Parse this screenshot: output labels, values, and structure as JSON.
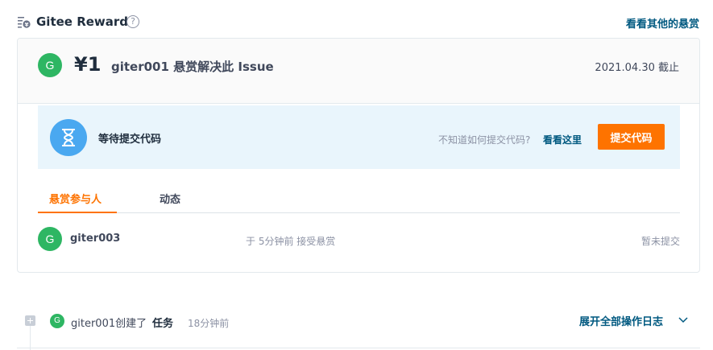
{
  "header": {
    "title": "Gitee Reward",
    "help_icon": "question-circle-icon",
    "help_glyph": "?",
    "other_link": "看看其他的悬赏"
  },
  "reward": {
    "avatar_letter": "G",
    "amount": "¥1",
    "title": "giter001 悬赏解决此 Issue",
    "deadline": "2021.04.30 截止"
  },
  "status": {
    "icon": "hourglass-icon",
    "text": "等待提交代码",
    "hint": "不知道如何提交代码?",
    "hint_link": "看看这里",
    "submit_label": "提交代码"
  },
  "tabs": [
    {
      "label": "悬赏参与人",
      "active": true
    },
    {
      "label": "动态",
      "active": false
    }
  ],
  "participants": [
    {
      "avatar_letter": "G",
      "name": "giter003",
      "time": "于 5分钟前 接受悬赏",
      "status": "暂未提交"
    }
  ],
  "log": {
    "expand_icon": "plus-square-icon",
    "avatar_letter": "G",
    "actor_action": "giter001创建了",
    "object": "任务",
    "time": "18分钟前",
    "expand_all": "展开全部操作日志"
  },
  "colors": {
    "accent": "#fe7300",
    "link": "#005980",
    "avatar": "#2eb663",
    "status_bg": "#e9f5fc",
    "status_icon_bg": "#4aa8f0"
  }
}
